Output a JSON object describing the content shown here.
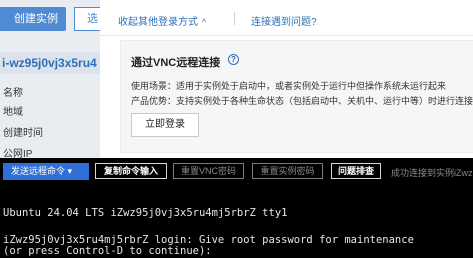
{
  "console": {
    "create_button": "创建实例",
    "partial_button": "选",
    "instance_id_partial": "i-wz95j0vj3x5ru4",
    "properties": [
      "名称",
      "地域",
      "创建时间",
      "公网IP"
    ]
  },
  "modal": {
    "collapse_link": "收起其他登录方式",
    "collapse_chevron": "^",
    "problem_link": "连接遇到问题?",
    "vnc": {
      "title": "通过VNC远程连接",
      "help_icon": "?",
      "usage_line": "使用场景：适用于实例处于启动中，或者实例处于运行中但操作系统未运行起来",
      "advantage_line": "产品优势：支持实例处于各种生命状态（包括启动中、关机中、运行中等）时进行连接",
      "login_button": "立即登录"
    }
  },
  "toolbar": {
    "send_command": "发送远程命令",
    "send_chevron": "▾",
    "copy_command": "复制命令输入",
    "reset_vnc_password": "重置VNC密码",
    "reset_instance_password": "重置实例密码",
    "troubleshoot": "问题排查",
    "status": "成功连接到实例iZwz"
  },
  "terminal": {
    "lines": [
      "Ubuntu 24.04 LTS iZwz95j0vj3x5ru4mj5rbrZ tty1",
      "iZwz95j0vj3x5ru4mj5rbrZ login: Give root password for maintenance",
      "(or press Control-D to continue):"
    ]
  },
  "colors": {
    "accent_blue": "#2f6fd6",
    "link_blue": "#2f6fb6",
    "terminal_bg": "#000000",
    "terminal_text": "#e6e6e6"
  }
}
